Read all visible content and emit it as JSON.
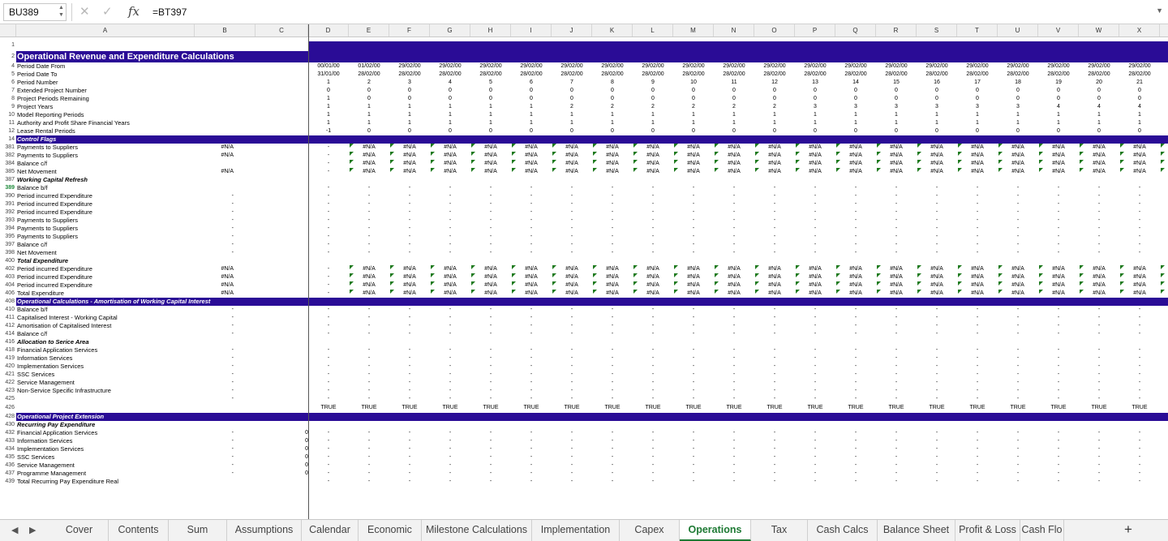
{
  "formula_bar": {
    "cell_ref": "BU389",
    "formula": "=BT397",
    "fx": "fx",
    "cancel": "✕",
    "confirm": "✓"
  },
  "colors": {
    "header_band": "#2a0c96",
    "accent": "#1e7a34",
    "flag": "#1f7a1f"
  },
  "column_headers": [
    "A",
    "B",
    "C",
    "D",
    "E",
    "F",
    "G",
    "H",
    "I",
    "J",
    "K",
    "L",
    "M",
    "N",
    "O",
    "P",
    "Q",
    "R",
    "S",
    "T",
    "U",
    "V",
    "W",
    "X"
  ],
  "rows": [
    {
      "n": "1",
      "label": ""
    },
    {
      "n": "2",
      "label": "Operational Revenue and Expenditure Calculations",
      "style": "title"
    },
    {
      "n": "4",
      "label": "Period Date From",
      "vals": [
        "00/01/00",
        "01/02/00",
        "29/02/00",
        "29/02/00",
        "29/02/00",
        "29/02/00",
        "29/02/00",
        "29/02/00",
        "29/02/00",
        "29/02/00",
        "29/02/00",
        "29/02/00",
        "29/02/00",
        "29/02/00",
        "29/02/00",
        "29/02/00",
        "29/02/00",
        "29/02/00",
        "29/02/00",
        "29/02/00",
        "29/02/00"
      ]
    },
    {
      "n": "5",
      "label": "Period Date To",
      "vals": [
        "31/01/00",
        "28/02/00",
        "28/02/00",
        "28/02/00",
        "28/02/00",
        "28/02/00",
        "28/02/00",
        "28/02/00",
        "28/02/00",
        "28/02/00",
        "28/02/00",
        "28/02/00",
        "28/02/00",
        "28/02/00",
        "28/02/00",
        "28/02/00",
        "28/02/00",
        "28/02/00",
        "28/02/00",
        "28/02/00",
        "28/02/00"
      ]
    },
    {
      "n": "6",
      "label": "Period Number",
      "vals": [
        "1",
        "2",
        "3",
        "4",
        "5",
        "6",
        "7",
        "8",
        "9",
        "10",
        "11",
        "12",
        "13",
        "14",
        "15",
        "16",
        "17",
        "18",
        "19",
        "20",
        "21"
      ]
    },
    {
      "n": "7",
      "label": "Extended Project Number",
      "vals": [
        "0",
        "0",
        "0",
        "0",
        "0",
        "0",
        "0",
        "0",
        "0",
        "0",
        "0",
        "0",
        "0",
        "0",
        "0",
        "0",
        "0",
        "0",
        "0",
        "0",
        "0"
      ]
    },
    {
      "n": "8",
      "label": "Project Periods Remaining",
      "vals": [
        "1",
        "0",
        "0",
        "0",
        "0",
        "0",
        "0",
        "0",
        "0",
        "0",
        "0",
        "0",
        "0",
        "0",
        "0",
        "0",
        "0",
        "0",
        "0",
        "0",
        "0"
      ]
    },
    {
      "n": "9",
      "label": "Project Years",
      "vals": [
        "1",
        "1",
        "1",
        "1",
        "1",
        "1",
        "2",
        "2",
        "2",
        "2",
        "2",
        "2",
        "3",
        "3",
        "3",
        "3",
        "3",
        "3",
        "4",
        "4",
        "4"
      ]
    },
    {
      "n": "10",
      "label": "Model Reporting Periods",
      "vals": [
        "1",
        "1",
        "1",
        "1",
        "1",
        "1",
        "1",
        "1",
        "1",
        "1",
        "1",
        "1",
        "1",
        "1",
        "1",
        "1",
        "1",
        "1",
        "1",
        "1",
        "1"
      ]
    },
    {
      "n": "11",
      "label": "Authority and Profit Share Financial Years",
      "vals": [
        "1",
        "1",
        "1",
        "1",
        "1",
        "1",
        "1",
        "1",
        "1",
        "1",
        "1",
        "1",
        "1",
        "1",
        "1",
        "1",
        "1",
        "1",
        "1",
        "1",
        "1"
      ]
    },
    {
      "n": "12",
      "label": "Lease Rental Periods",
      "vals": [
        "-1",
        "0",
        "0",
        "0",
        "0",
        "0",
        "0",
        "0",
        "0",
        "0",
        "0",
        "0",
        "0",
        "0",
        "0",
        "0",
        "0",
        "0",
        "0",
        "0",
        "0"
      ]
    },
    {
      "n": "14",
      "label": "Control Flags",
      "style": "hdr"
    },
    {
      "n": "381",
      "label": "Payments to Suppliers",
      "b": "#N/A",
      "fill": "na"
    },
    {
      "n": "382",
      "label": "Payments to Suppliers",
      "b": "#N/A",
      "fill": "na"
    },
    {
      "n": "384",
      "label": "Balance c/f",
      "fill": "na"
    },
    {
      "n": "385",
      "label": "Net Movement",
      "b": "#N/A",
      "fill": "na"
    },
    {
      "n": "387",
      "label": "Working Capital Refresh",
      "style": "it"
    },
    {
      "n": "389",
      "label": "Balance b/f",
      "fill": "dash",
      "sel": true
    },
    {
      "n": "390",
      "label": "Period incurred Expenditure",
      "b": "-",
      "fill": "dash"
    },
    {
      "n": "391",
      "label": "Period incurred Expenditure",
      "b": "-",
      "fill": "dash"
    },
    {
      "n": "392",
      "label": "Period incurred Expenditure",
      "b": "-",
      "fill": "dash"
    },
    {
      "n": "393",
      "label": "Payments to Suppliers",
      "b": "-",
      "fill": "dash"
    },
    {
      "n": "394",
      "label": "Payments to Suppliers",
      "b": "-",
      "fill": "dash"
    },
    {
      "n": "395",
      "label": "Payments to Suppliers",
      "b": "-",
      "fill": "dash"
    },
    {
      "n": "397",
      "label": "Balance c/f",
      "b": "-",
      "fill": "dash"
    },
    {
      "n": "398",
      "label": "Net Movement",
      "b": "-",
      "fill": "dash"
    },
    {
      "n": "400",
      "label": "Total Expenditure",
      "style": "it"
    },
    {
      "n": "402",
      "label": "Period incurred Expenditure",
      "b": "#N/A",
      "fill": "na"
    },
    {
      "n": "403",
      "label": "Period incurred Expenditure",
      "b": "#N/A",
      "fill": "na"
    },
    {
      "n": "404",
      "label": "Period incurred Expenditure",
      "b": "#N/A",
      "fill": "na"
    },
    {
      "n": "406",
      "label": "Total Expenditure",
      "b": "#N/A",
      "fill": "na"
    },
    {
      "n": "408",
      "label": "Operational Calculations - Amortisation of Working Capital Interest",
      "style": "hdr"
    },
    {
      "n": "410",
      "label": "Balance b/f",
      "b": "-",
      "fill": "dash"
    },
    {
      "n": "411",
      "label": "Capitalised Interest - Working Capital",
      "b": "-",
      "fill": "dash"
    },
    {
      "n": "412",
      "label": "Amortisation of Capitalised Interest",
      "b": "-",
      "fill": "dash"
    },
    {
      "n": "414",
      "label": "Balance c/f",
      "b": "-",
      "fill": "dash"
    },
    {
      "n": "416",
      "label": "Allocation to Serice Area",
      "style": "it"
    },
    {
      "n": "418",
      "label": "Financial Application Services",
      "b": "-",
      "fill": "dash"
    },
    {
      "n": "419",
      "label": "Information Services",
      "b": "-",
      "fill": "dash"
    },
    {
      "n": "420",
      "label": "Implementation  Services",
      "b": "-",
      "fill": "dash"
    },
    {
      "n": "421",
      "label": "SSC Services",
      "b": "-",
      "fill": "dash"
    },
    {
      "n": "422",
      "label": "Service Management",
      "b": "-",
      "fill": "dash"
    },
    {
      "n": "423",
      "label": "Non-Service Specific Infrastructure",
      "b": "-",
      "fill": "dash"
    },
    {
      "n": "425",
      "label": "",
      "b": "-",
      "fill": "dash"
    },
    {
      "n": "426",
      "label": "",
      "fill": "true"
    },
    {
      "n": "428",
      "label": "Operational Project Extension",
      "style": "hdr"
    },
    {
      "n": "430",
      "label": "Recurring Pay Expenditure",
      "style": "it"
    },
    {
      "n": "432",
      "label": "Financial Application Services",
      "b": "-",
      "c": "0",
      "fill": "dash"
    },
    {
      "n": "433",
      "label": "Information Services",
      "b": "-",
      "c": "0",
      "fill": "dash"
    },
    {
      "n": "434",
      "label": "Implementation Services",
      "b": "-",
      "c": "0",
      "fill": "dash"
    },
    {
      "n": "435",
      "label": "SSC Services",
      "b": "-",
      "c": "0",
      "fill": "dash"
    },
    {
      "n": "436",
      "label": "Service Management",
      "b": "-",
      "c": "0",
      "fill": "dash"
    },
    {
      "n": "437",
      "label": "Programme Management",
      "b": "-",
      "c": "0",
      "fill": "dash"
    },
    {
      "n": "439",
      "label": "Total Recurring Pay Expenditure Real",
      "fill": "dash"
    }
  ],
  "tabs": [
    "Cover",
    "Contents",
    "Sum",
    "Assumptions",
    "Calendar",
    "Economic",
    "Milestone Calculations",
    "Implementation",
    "Capex",
    "Operations",
    "Tax",
    "Cash Calcs",
    "Balance Sheet",
    "Profit & Loss",
    "Cash Flo"
  ],
  "active_tab": "Operations",
  "add_sheet": "+",
  "nav": {
    "prev": "◀",
    "next": "▶"
  }
}
